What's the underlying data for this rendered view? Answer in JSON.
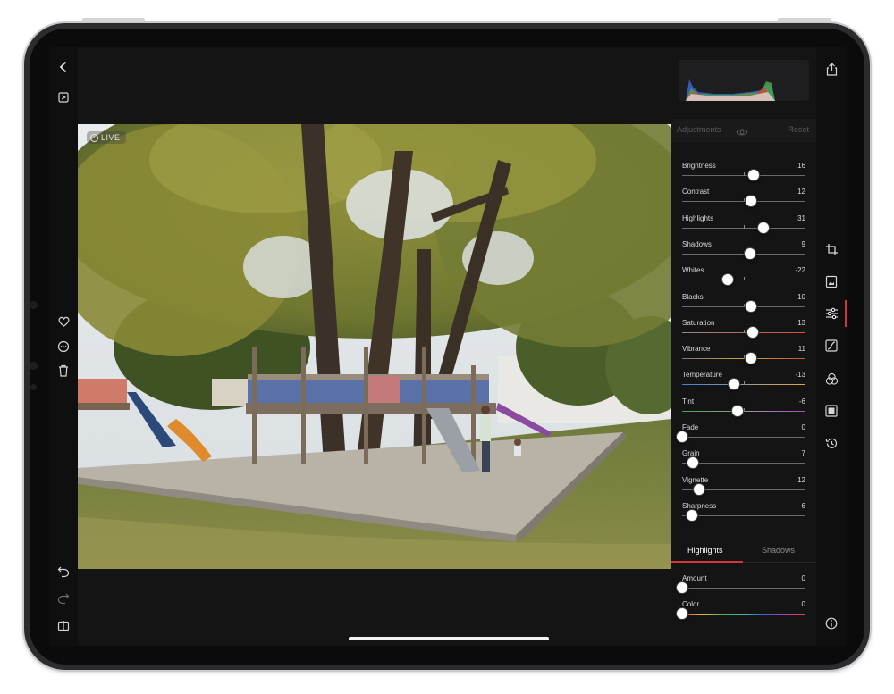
{
  "window": {
    "live_badge": "LIVE"
  },
  "histogram": {
    "icon": "histogram-graph"
  },
  "adjustments": {
    "title": "Adjustments",
    "reset_label": "Reset",
    "sliders": [
      {
        "label": "Brightness",
        "value": "16",
        "level": 0.58,
        "zero_tick": 0.5
      },
      {
        "label": "Contrast",
        "value": "12",
        "level": 0.56,
        "zero_tick": 0.5
      },
      {
        "label": "Highlights",
        "value": "31",
        "level": 0.66,
        "zero_tick": 0.5
      },
      {
        "label": "Shadows",
        "value": "9",
        "level": 0.55,
        "zero_tick": 0.5
      },
      {
        "label": "Whites",
        "value": "-22",
        "level": 0.37,
        "zero_tick": 0.5
      },
      {
        "label": "Blacks",
        "value": "10",
        "level": 0.56,
        "zero_tick": 0.5
      },
      {
        "label": "Saturation",
        "value": "13",
        "level": 0.57,
        "zero_tick": 0.5,
        "gradient": "saturation"
      },
      {
        "label": "Vibrance",
        "value": "11",
        "level": 0.56,
        "zero_tick": 0.5,
        "gradient": "vibrance"
      },
      {
        "label": "Temperature",
        "value": "-13",
        "level": 0.42,
        "zero_tick": 0.5,
        "gradient": "temperature"
      },
      {
        "label": "Tint",
        "value": "-6",
        "level": 0.45,
        "zero_tick": 0.5,
        "gradient": "tint"
      },
      {
        "label": "Fade",
        "value": "0",
        "level": 0.0
      },
      {
        "label": "Grain",
        "value": "7",
        "level": 0.09
      },
      {
        "label": "Vignette",
        "value": "12",
        "level": 0.14
      },
      {
        "label": "Sharpness",
        "value": "6",
        "level": 0.08
      }
    ]
  },
  "split_tone": {
    "tabs": [
      "Highlights",
      "Shadows"
    ],
    "active_tab": 0,
    "sliders": [
      {
        "label": "Amount",
        "value": "0",
        "level": 0.0
      },
      {
        "label": "Color",
        "value": "0",
        "level": 0.0,
        "gradient": "hue"
      }
    ]
  },
  "colors": {
    "accent": "#d2353a",
    "panel_bg": "#141414"
  },
  "icons": {
    "left": [
      "back-chevron-icon",
      "compare-icon",
      "heart-icon",
      "more-icon",
      "trash-icon",
      "undo-icon",
      "redo-icon",
      "split-view-icon"
    ],
    "right": [
      "share-icon",
      "crop-icon",
      "frame-icon",
      "adjust-sliders-icon",
      "curves-icon",
      "hsl-icon",
      "border-icon",
      "history-icon",
      "info-icon"
    ]
  }
}
